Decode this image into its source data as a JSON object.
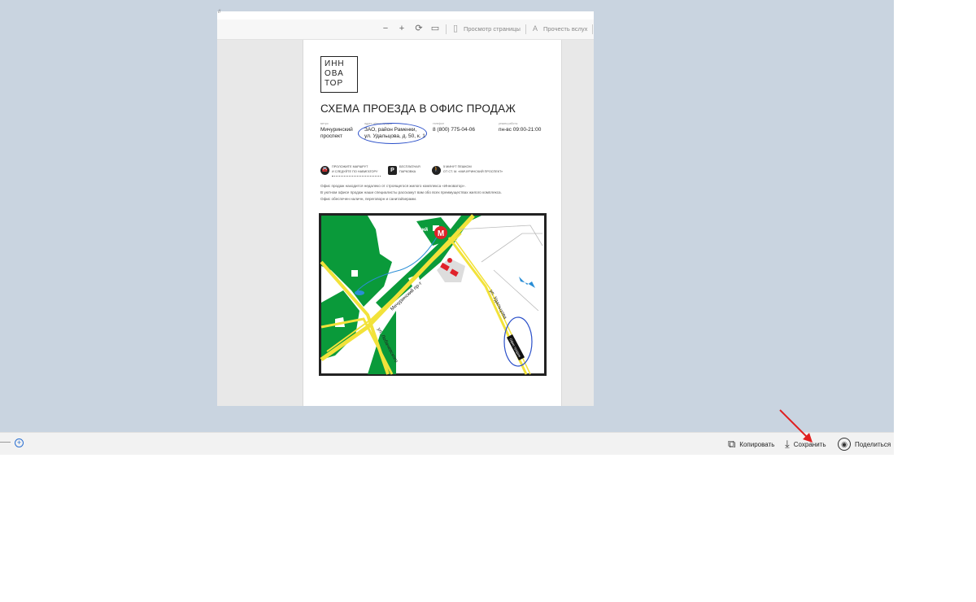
{
  "pdf": {
    "title_char": "//",
    "toolbar": {
      "zoom_out": "−",
      "zoom_in": "+",
      "rotate": "⟳",
      "fit": "▭",
      "page_view_icon": "▯",
      "page_view_label": "Просмотр страницы",
      "read_aloud_icon": "A",
      "read_aloud_label": "Прочесть вслух"
    }
  },
  "doc": {
    "logo": [
      "ИНН",
      "ОВА",
      "ТОР"
    ],
    "title": "СХЕМА ПРОЕЗДА В ОФИС ПРОДАЖ",
    "info": [
      {
        "label": "метро",
        "value_lines": [
          "Мичуринский",
          "проспект"
        ]
      },
      {
        "label": "адрес офиса продаж",
        "value_lines": [
          "ЗАО, район Раменки,",
          "ул. Удальцова, д. 50, к. 1"
        ]
      },
      {
        "label": "телефон",
        "value_lines": [
          "8 (800) 775-04-06"
        ]
      },
      {
        "label": "режим работы",
        "value_lines": [
          "пн-вс 09:00-21:00"
        ]
      }
    ],
    "features": [
      {
        "icon": "🚘",
        "lines": [
          "ПРОЛОЖИТЕ МАРШРУТ",
          "И СЛЕДУЙТЕ ПО НАВИГАТОРУ"
        ]
      },
      {
        "icon": "P",
        "lines": [
          "БЕСПЛАТНАЯ",
          "ПАРКОВКА"
        ]
      },
      {
        "icon": "🚶",
        "lines": [
          "5 МИНУТ ПЕШКОМ",
          "ОТ СТ. М. «МИЧУРИНСКИЙ ПРОСПЕКТ»"
        ]
      }
    ],
    "description": [
      "Офис продаж находится недалеко от строящегося жилого комплекса «Инноватор».",
      "В уютном офисе продаж наши специалисты расскажут вам обо всех преимуществах жилого комплекса.",
      "Офис обеспечен наличн, переговорн и санитайзерами."
    ],
    "map": {
      "metro_label_lines": [
        "Мичуринский",
        "проспект"
      ],
      "metro_letter": "М",
      "road_michurinsky": "Мичуринский пр-т",
      "road_udaltsova": "ул. Удальцова",
      "road_lobachevskogo": "ул. Лобачевского",
      "office_badge": "Офис продаж"
    }
  },
  "bottom_bar": {
    "copy_icon": "⧉",
    "copy_label": "Копировать",
    "save_icon": "⤓",
    "save_label": "Сохранить",
    "share_icon": "◉",
    "share_label": "Поделиться",
    "zoom_plus": "+"
  },
  "colors": {
    "viewer_background": "#c9d4e0",
    "map_green": "#0a9a3a",
    "map_road": "#f2e23a",
    "metro_red": "#e0222a",
    "annotation_blue": "#2a4fc9",
    "arrow_red": "#e02020"
  }
}
